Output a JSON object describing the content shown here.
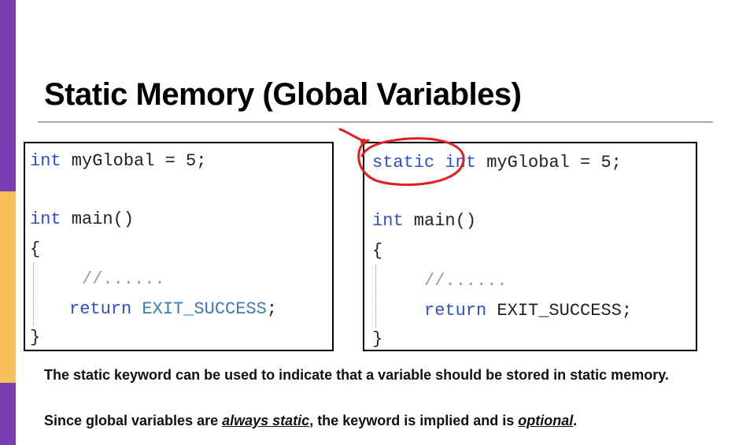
{
  "slide": {
    "title": "Static Memory (Global Variables)",
    "colors": {
      "stripe_purple": "#7a3eb0",
      "stripe_yellow": "#f6c15a",
      "keyword": "#2f4fc9",
      "macro": "#3a7bb5",
      "annotation": "#e02020"
    }
  },
  "left_code": {
    "line1": {
      "kw": "int",
      "rest": " myGlobal = 5;"
    },
    "line2": {
      "kw": "int",
      "rest": " main()"
    },
    "open_brace": "{",
    "comment": "//......",
    "ret_kw": "return",
    "ret_macro": " EXIT_SUCCESS",
    "ret_end": ";",
    "close_brace": "}"
  },
  "right_code": {
    "line1": {
      "kw_static": "static",
      "kw_int": " int",
      "rest": " myGlobal = 5;"
    },
    "line2": {
      "kw": "int",
      "rest": " main()"
    },
    "open_brace": "{",
    "comment": "//......",
    "ret_kw": "return",
    "ret_rest": " EXIT_SUCCESS;",
    "close_brace": "}"
  },
  "text": {
    "para1": "The static keyword can be used to indicate that a variable should be stored in static memory.",
    "para2_pre": "Since global variables are ",
    "para2_em1": "always static",
    "para2_mid": ", the keyword is implied and is ",
    "para2_em2": "optional",
    "para2_end": "."
  }
}
